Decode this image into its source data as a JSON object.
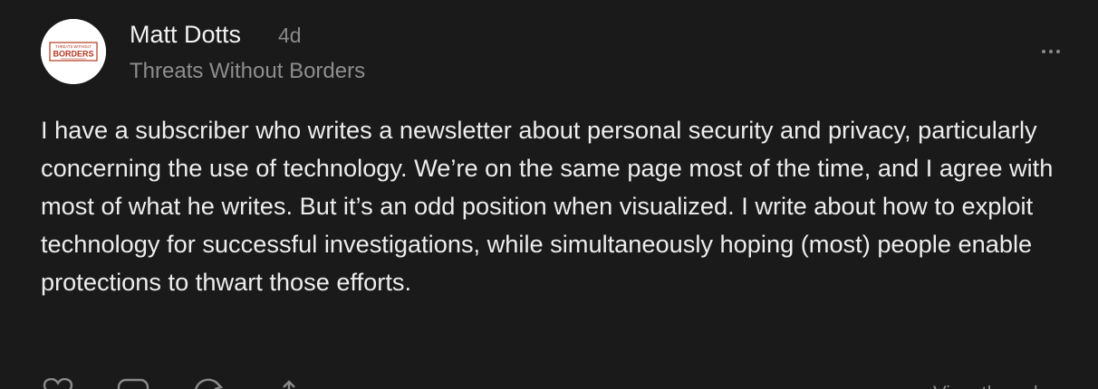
{
  "post": {
    "author": "Matt Dotts",
    "age": "4d",
    "publication": "Threats Without Borders",
    "avatar": {
      "logo_line1": "THREATS WITHOUT",
      "logo_line2": "BORDERS",
      "brand_color": "#b5371f"
    },
    "body": "I have a subscriber who writes a newsletter about personal security and privacy, particularly concerning the use of technology. We’re on the same page most of the time, and I agree with most of what he writes. But it’s an odd position when visualized. I write about how to exploit technology for successful investigations, while simultaneously hoping (most) people enable protections to thwart those efforts."
  },
  "actions": {
    "icons": [
      "heart-icon",
      "comment-icon",
      "restack-icon",
      "share-icon",
      "more-horizontal-icon"
    ],
    "view_link": "View thread"
  },
  "colors": {
    "background": "#1a1a1a",
    "text_primary": "#ededed",
    "text_secondary": "#8e8e8e"
  }
}
